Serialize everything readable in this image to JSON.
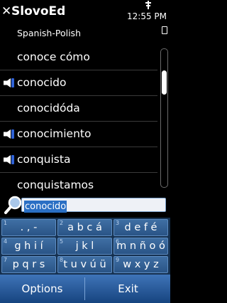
{
  "header": {
    "title": "SlovoEd",
    "clock": "12:55 PM",
    "dictionary": "Spanish-Polish"
  },
  "words": [
    {
      "text": "conoce cómo",
      "audio": false
    },
    {
      "text": "conocido",
      "audio": true
    },
    {
      "text": "conocidóda",
      "audio": false
    },
    {
      "text": "conocimiento",
      "audio": true
    },
    {
      "text": "conquista",
      "audio": true
    },
    {
      "text": "conquistamos",
      "audio": false
    }
  ],
  "search": {
    "value": "conocido"
  },
  "keypad": {
    "keys": [
      {
        "num": "1",
        "label": ". , -"
      },
      {
        "num": "2",
        "label": "a b c á"
      },
      {
        "num": "3",
        "label": "d e f é"
      },
      {
        "num": "4",
        "label": "g h i í"
      },
      {
        "num": "5",
        "label": "j k l"
      },
      {
        "num": "6",
        "label": "m n ñ o ó"
      },
      {
        "num": "7",
        "label": "p q r s"
      },
      {
        "num": "8",
        "label": "t u v ú ü"
      },
      {
        "num": "9",
        "label": "w x y z"
      }
    ]
  },
  "softkeys": {
    "left": "Options",
    "right": "Exit"
  },
  "colors": {
    "keypad_bg": "#15304f",
    "key_top": "#3f6fa4",
    "softkey_bar": "#2a5e9e",
    "selection": "#2a6fc4"
  }
}
